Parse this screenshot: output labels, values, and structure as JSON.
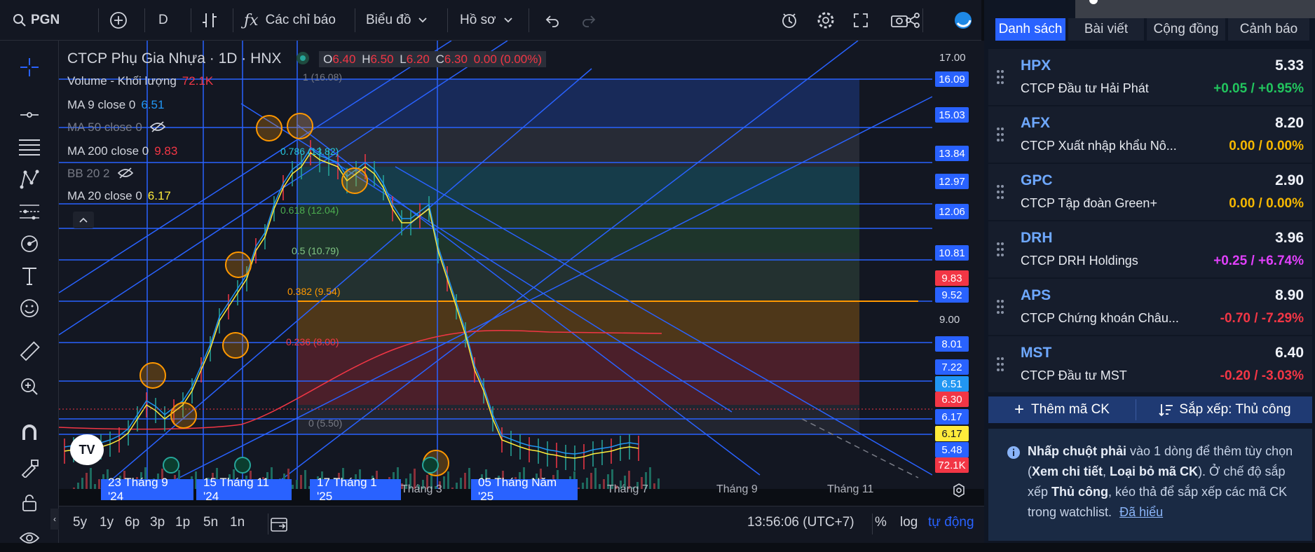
{
  "topbar": {
    "symbol": "PGN",
    "interval": "D",
    "indicators_label": "Các chỉ báo",
    "chart_type_label": "Biểu đồ",
    "profile_label": "Hồ sơ"
  },
  "legend": {
    "title": "CTCP Phụ Gia Nhựa · 1D · HNX",
    "ohlc": {
      "o_label": "O",
      "o": "6.40",
      "h_label": "H",
      "h": "6.50",
      "l_label": "L",
      "l": "6.20",
      "c_label": "C",
      "c": "6.30",
      "change": "0.00 (0.00%)"
    },
    "indicators": [
      {
        "label": "Volume - Khối lượng",
        "value": "72.1K",
        "color": "#f23645"
      },
      {
        "label": "MA 9 close 0",
        "value": "6.51",
        "color": "#2196f3"
      },
      {
        "label": "MA 50 close 0",
        "value": "",
        "color": "#787b86"
      },
      {
        "label": "MA 200 close 0",
        "value": "9.83",
        "color": "#f23645"
      },
      {
        "label": "BB 20 2",
        "value": "",
        "color": "#787b86"
      },
      {
        "label": "MA 20 close 0",
        "value": "6.17",
        "color": "#ffeb3b"
      }
    ]
  },
  "fib_labels": [
    {
      "text": "1 (16.08)",
      "color": "#787b86"
    },
    {
      "text": "0.786 (13.82)",
      "color": "#26c6da"
    },
    {
      "text": "0.618 (12.04)",
      "color": "#4caf50"
    },
    {
      "text": "0.5 (10.79)",
      "color": "#81c784"
    },
    {
      "text": "0.382 (9.54)",
      "color": "#ff9800"
    },
    {
      "text": "0.236 (8.00)",
      "color": "#f23645"
    },
    {
      "text": "0 (5.50)",
      "color": "#787b86"
    }
  ],
  "price_axis": {
    "labels": [
      "17.00",
      "9.00"
    ],
    "tags": [
      {
        "value": "16.09",
        "color": "#2962ff"
      },
      {
        "value": "15.03",
        "color": "#2962ff"
      },
      {
        "value": "13.84",
        "color": "#2962ff"
      },
      {
        "value": "12.97",
        "color": "#2962ff"
      },
      {
        "value": "12.06",
        "color": "#2962ff"
      },
      {
        "value": "10.81",
        "color": "#2962ff"
      },
      {
        "value": "9.83",
        "color": "#f23645"
      },
      {
        "value": "9.52",
        "color": "#2962ff"
      },
      {
        "value": "8.01",
        "color": "#2962ff"
      },
      {
        "value": "7.22",
        "color": "#2962ff"
      },
      {
        "value": "6.51",
        "color": "#2196f3"
      },
      {
        "value": "6.30",
        "color": "#f23645"
      },
      {
        "value": "6.17",
        "color": "#2962ff"
      },
      {
        "value": "6.17",
        "color": "#ffeb3b"
      },
      {
        "value": "5.48",
        "color": "#2962ff"
      },
      {
        "value": "72.1K",
        "color": "#f23645"
      }
    ]
  },
  "time_axis": {
    "date_tags": [
      "23 Tháng 9 '24",
      "15 Tháng 11 '24",
      "17 Tháng 1 '25",
      "05 Tháng Năm '25"
    ],
    "months": [
      "Tháng 3",
      "Tháng 7",
      "Tháng 9",
      "Tháng 11"
    ]
  },
  "bottombar": {
    "ranges": [
      "5y",
      "1y",
      "6p",
      "3p",
      "1p",
      "5n",
      "1n"
    ],
    "time": "13:56:06 (UTC+7)",
    "percent": "%",
    "log": "log",
    "auto": "tự động"
  },
  "watchlist": {
    "tabs": [
      "Danh sách",
      "Bài viết",
      "Cộng đồng",
      "Cảnh báo"
    ],
    "items": [
      {
        "symbol": "HPX",
        "price": "5.33",
        "name": "CTCP Đầu tư Hải Phát",
        "change": "+0.05 / +0.95%",
        "color": "#22c55e"
      },
      {
        "symbol": "AFX",
        "price": "8.20",
        "name": "CTCP Xuất nhập khẩu Nô...",
        "change": "0.00 / 0.00%",
        "color": "#f5b700"
      },
      {
        "symbol": "GPC",
        "price": "2.90",
        "name": "CTCP Tập đoàn Green+",
        "change": "0.00 / 0.00%",
        "color": "#f5b700"
      },
      {
        "symbol": "DRH",
        "price": "3.96",
        "name": "CTCP DRH Holdings",
        "change": "+0.25 / +6.74%",
        "color": "#e040fb"
      },
      {
        "symbol": "APS",
        "price": "8.90",
        "name": "CTCP Chứng khoán Châu...",
        "change": "-0.70 / -7.29%",
        "color": "#f23645"
      },
      {
        "symbol": "MST",
        "price": "6.40",
        "name": "CTCP Đầu tư MST",
        "change": "-0.20 / -3.03%",
        "color": "#f23645"
      }
    ],
    "add_label": "Thêm mã CK",
    "sort_label": "Sắp xếp: Thủ công",
    "tip": {
      "part1": "Nhấp chuột phải",
      "part2": " vào 1 dòng để thêm tùy chọn (",
      "part3": "Xem chi tiết",
      "part4": ", ",
      "part5": "Loại bỏ mã CK",
      "part6": "). Ở chế độ sắp xếp ",
      "part7": "Thủ công",
      "part8": ", kéo thả để sắp xếp các mã CK trong watchlist.",
      "link": "Đã hiểu"
    }
  },
  "icons": [
    "search-icon",
    "plus-circle-icon",
    "bar-type-icon",
    "fx-icon",
    "chevron-down-icon",
    "undo-icon",
    "redo-icon",
    "alert-icon",
    "gear-icon",
    "fullscreen-icon",
    "camera-icon",
    "share-icon",
    "crosshair-icon",
    "trend-line-icon",
    "fib-icon",
    "pattern-icon",
    "forecast-icon",
    "brush-icon",
    "text-icon",
    "emoji-icon",
    "ruler-icon",
    "zoom-in-icon",
    "magnet-icon",
    "lock-drawings-icon",
    "lock-icon",
    "eye-icon",
    "info-icon",
    "grip-icon",
    "sort-icon",
    "calendar-goto-icon",
    "settings-axis-icon",
    "tv-logo-icon"
  ]
}
